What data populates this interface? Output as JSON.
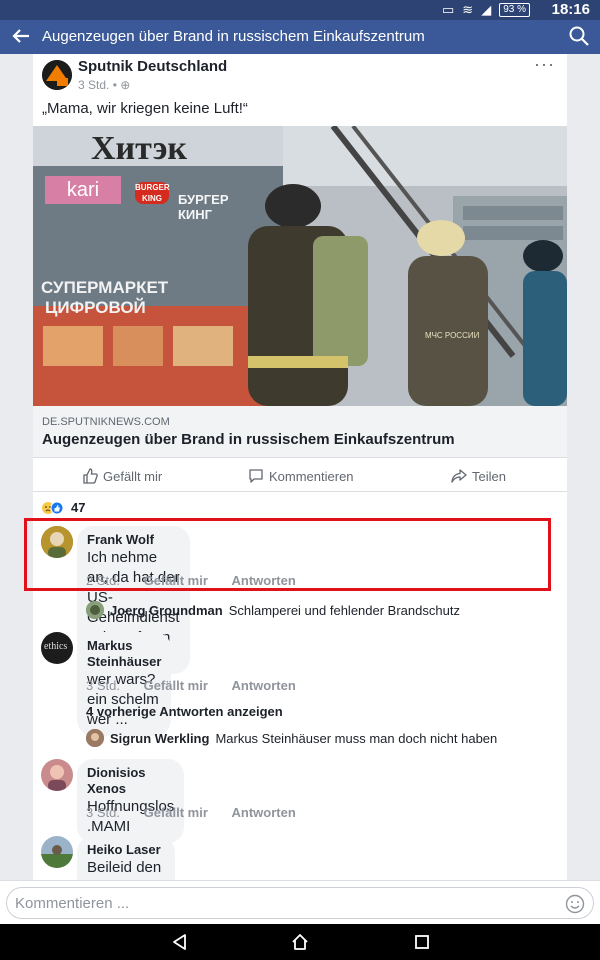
{
  "status_bar": {
    "battery": "93 %",
    "time": "18:16"
  },
  "app_bar": {
    "title": "Augenzeugen über Brand in russischem Einkaufszentrum"
  },
  "post": {
    "author": "Sputnik Deutschland",
    "time": "3 Std. •",
    "text": "„Mama, wir kriegen keine Luft!“",
    "photo_signs": {
      "sign1": "Хитэк",
      "sign2": "kari",
      "sign3": "БУРГЕР КИНГ",
      "sign3_logo": "BURGER KING",
      "sign4": "СУПЕРМАРКЕТ",
      "sign5": "ЦИФРОВОЙ",
      "sign6": "МЧС РОССИИ"
    },
    "link_domain": "DE.SPUTNIKNEWS.COM",
    "link_title": "Augenzeugen über Brand in russischem Einkaufszentrum",
    "actions": {
      "like": "Gefällt mir",
      "comment": "Kommentieren",
      "share": "Teilen"
    },
    "reaction_count": "47"
  },
  "comments": [
    {
      "name": "Frank Wolf",
      "text": "Ich nehme an, da hat der US-Geheimdienst seine Pfoten drin!",
      "time": "2 Std.",
      "like": "Gefällt mir",
      "reply": "Antworten"
    },
    {
      "name": "Markus Steinhäuser",
      "text": "wer wars? ein schelm wer ...",
      "time": "3 Std.",
      "like": "Gefällt mir",
      "reply": "Antworten",
      "avatar_text": "ethics"
    },
    {
      "name": "Dionisios Xenos",
      "text": "Hoffnungslos .MAMI",
      "time": "3 Std.",
      "like": "Gefällt mir",
      "reply": "Antworten"
    },
    {
      "name": "Heiko Laser",
      "text": "Beileid den Familien....."
    }
  ],
  "replies": [
    {
      "name": "Joerg Groundman",
      "text": "Schlamperei und fehlender Brandschutz"
    },
    {
      "name": "Sigrun Werkling",
      "text": "Markus Steinhäuser muss man doch nicht haben"
    }
  ],
  "show_previous": "4 vorherige Antworten anzeigen",
  "composer": {
    "placeholder": "Kommentieren ..."
  },
  "colors": {
    "facebook_blue": "#3b5998",
    "highlight": "#e1111a"
  }
}
